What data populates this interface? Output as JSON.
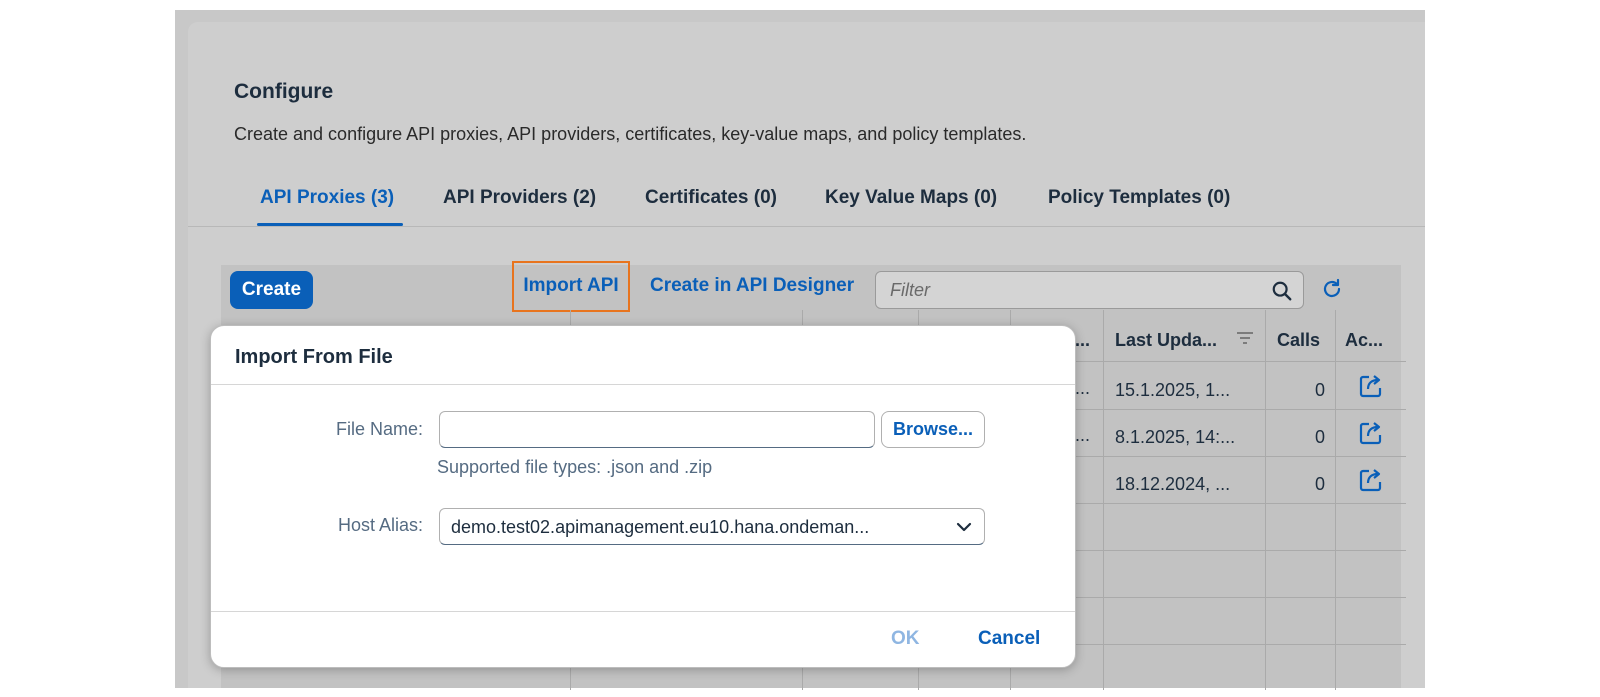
{
  "page": {
    "title": "Configure",
    "description": "Create and configure API proxies, API providers, certificates, key-value maps, and policy templates."
  },
  "tabs": [
    {
      "label": "API Proxies (3)",
      "active": true
    },
    {
      "label": "API Providers (2)"
    },
    {
      "label": "Certificates (0)"
    },
    {
      "label": "Key Value Maps (0)"
    },
    {
      "label": "Policy Templates (0)"
    }
  ],
  "toolbar": {
    "create_label": "Create",
    "import_label": "Import API",
    "designer_label": "Create in API Designer",
    "filter_placeholder": "Filter"
  },
  "table": {
    "headers": {
      "truncated": "...",
      "last_updated": "Last Upda...",
      "calls": "Calls",
      "actions": "Ac..."
    },
    "rows": [
      {
        "truncated": "...",
        "last_updated": "15.1.2025, 1...",
        "calls": "0"
      },
      {
        "truncated": "...",
        "last_updated": "8.1.2025, 14:...",
        "calls": "0"
      },
      {
        "truncated": "",
        "last_updated": "18.12.2024, ...",
        "calls": "0"
      }
    ]
  },
  "dialog": {
    "title": "Import From File",
    "file_name_label": "File Name:",
    "file_name_value": "",
    "browse_label": "Browse...",
    "hint": "Supported file types: .json and .zip",
    "host_alias_label": "Host Alias:",
    "host_alias_value": "demo.test02.apimanagement.eu10.hana.ondeman...",
    "ok_label": "OK",
    "cancel_label": "Cancel"
  },
  "colors": {
    "accent": "#0a5fb8",
    "highlight": "#e8741e",
    "disabled": "#8fb6e2"
  },
  "icons": [
    "search-icon",
    "refresh-icon",
    "sort-icon",
    "share-icon",
    "chevron-down-icon"
  ]
}
